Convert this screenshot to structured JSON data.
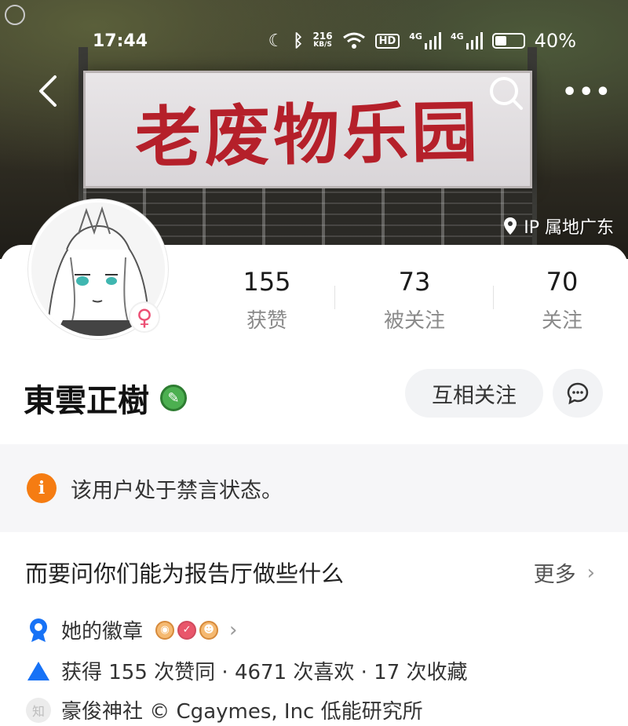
{
  "banner": {
    "sign_text": "老废物乐园",
    "ip_location": "IP 属地广东"
  },
  "status_bar": {
    "time": "17:44",
    "net_speed_value": "216",
    "net_speed_unit": "KB/S",
    "hd_label": "HD",
    "signal1_label": "4G",
    "signal2_label": "4G",
    "battery_percent": "40%",
    "battery_level": 0.4
  },
  "profile": {
    "name": "東雲正樹",
    "gender": "female",
    "stats": [
      {
        "value": "155",
        "label": "获赞"
      },
      {
        "value": "73",
        "label": "被关注"
      },
      {
        "value": "70",
        "label": "关注"
      }
    ],
    "mutual_follow_label": "互相关注"
  },
  "notice": {
    "text": "该用户处于禁言状态。"
  },
  "info": {
    "bio": "而要问你们能为报告厅做些什么",
    "more_label": "更多",
    "badges_label": "她的徽章",
    "likes_text": "获得 155 次赞同 · 4671 次喜欢 · 17 次收藏",
    "org_icon_char": "知",
    "org_text": "豪俊神社 © Cgaymes, Inc 低能研究所"
  },
  "colors": {
    "accent_orange": "#f57c12",
    "female_pink": "#ec4f74",
    "blue_icon": "#1772f6",
    "verified_green": "#4caf50"
  }
}
